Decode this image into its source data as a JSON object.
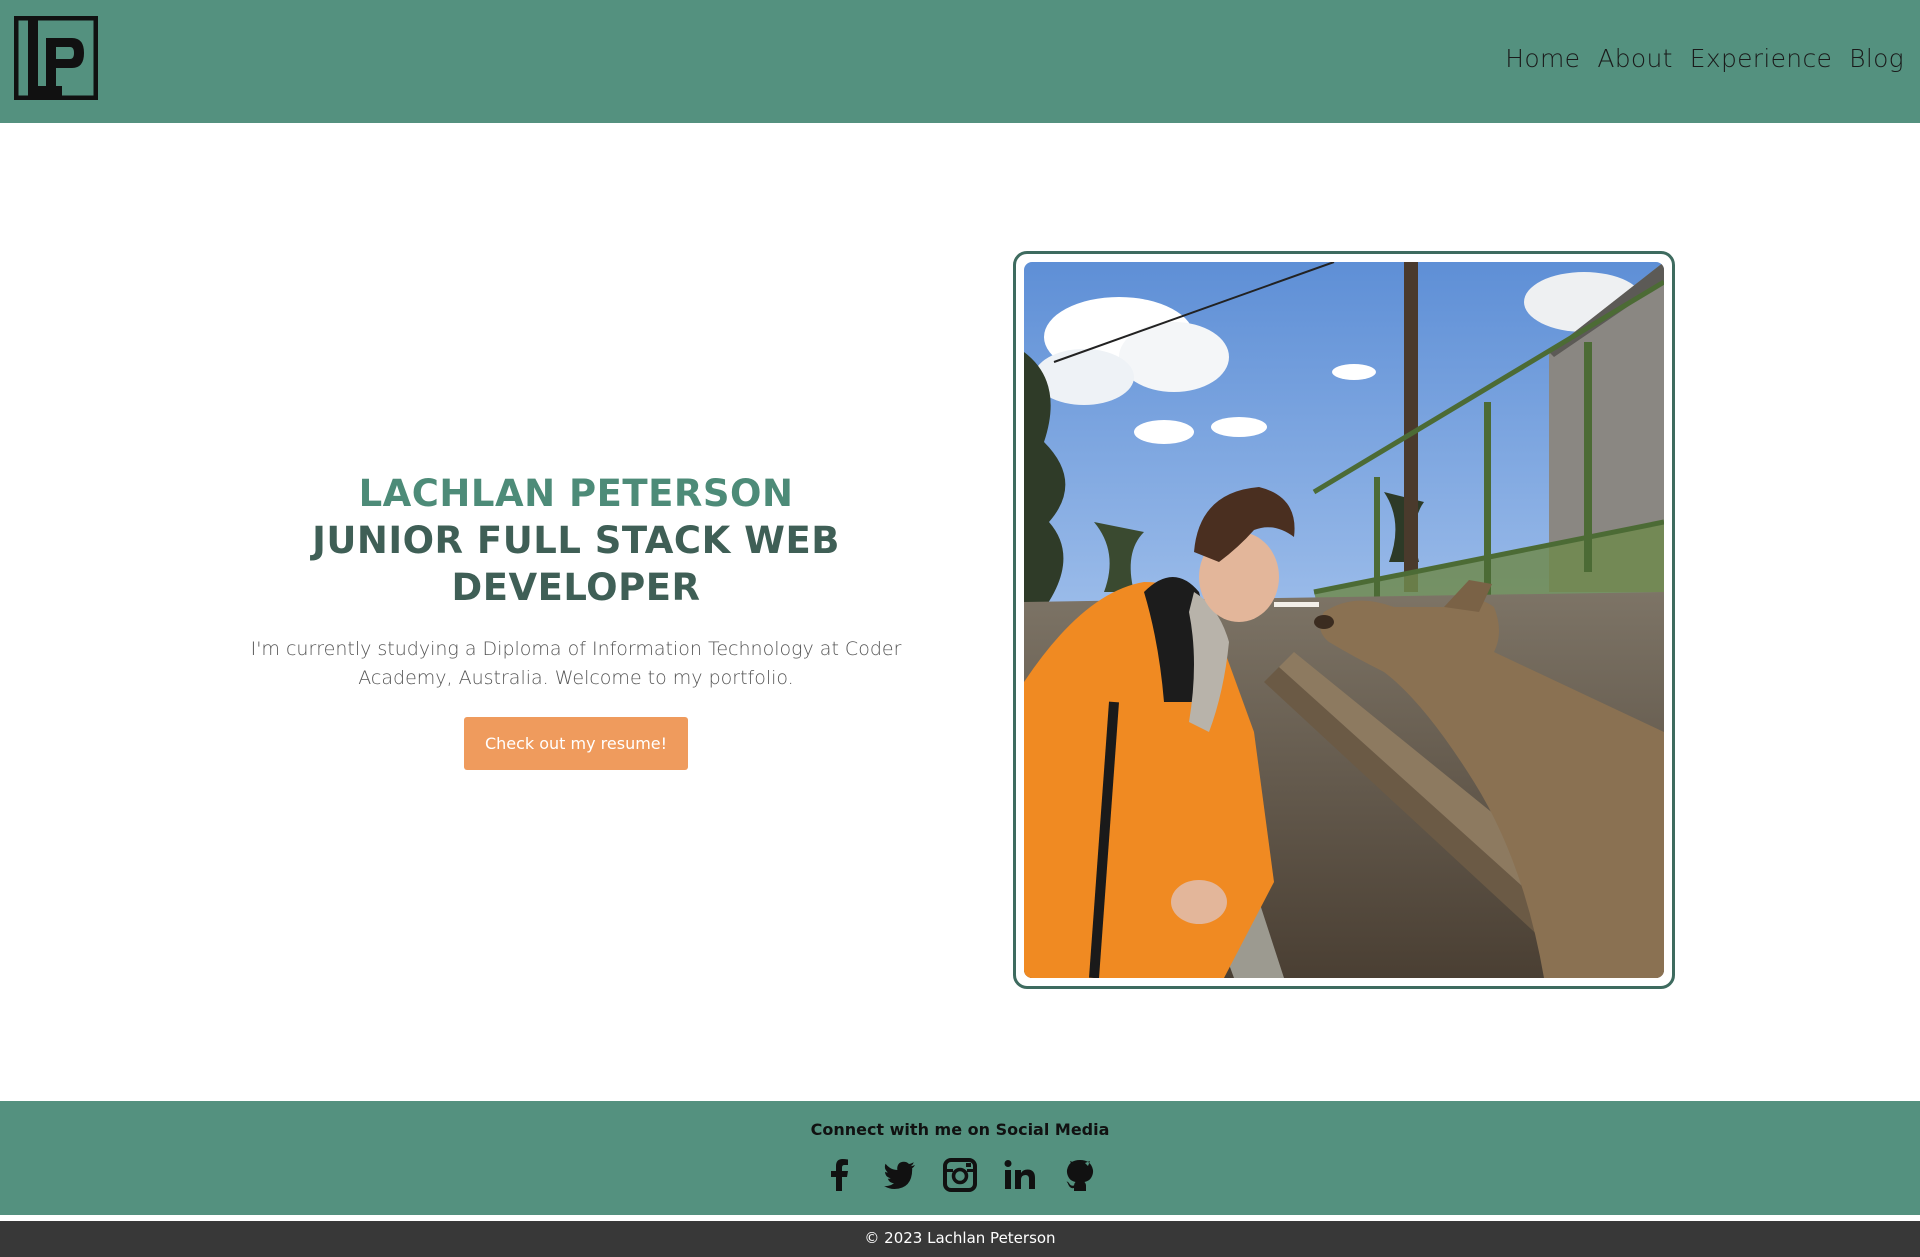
{
  "header": {
    "logo_icon": "lp-monogram-logo",
    "nav": [
      {
        "label": "Home"
      },
      {
        "label": "About"
      },
      {
        "label": "Experience"
      },
      {
        "label": "Blog"
      }
    ]
  },
  "hero": {
    "name": "LACHLAN PETERSON",
    "role": "JUNIOR FULL STACK WEB DEVELOPER",
    "description": "I'm currently studying a Diploma of Information Technology at Coder Academy, Australia. Welcome to my portfolio.",
    "button_label": "Check out my resume!"
  },
  "photo": {
    "subject": "profile-photo"
  },
  "footer": {
    "social_title": "Connect with me on Social Media",
    "social_icons": [
      "facebook-icon",
      "twitter-icon",
      "instagram-icon",
      "linkedin-icon",
      "github-icon"
    ],
    "copyright": "© 2023 Lachlan Peterson"
  },
  "colors": {
    "header_bg": "#54917f",
    "name_color": "#4d8b78",
    "role_color": "#3f5f56",
    "button_bg": "#ef9b5d",
    "copyright_bg": "#383838"
  }
}
